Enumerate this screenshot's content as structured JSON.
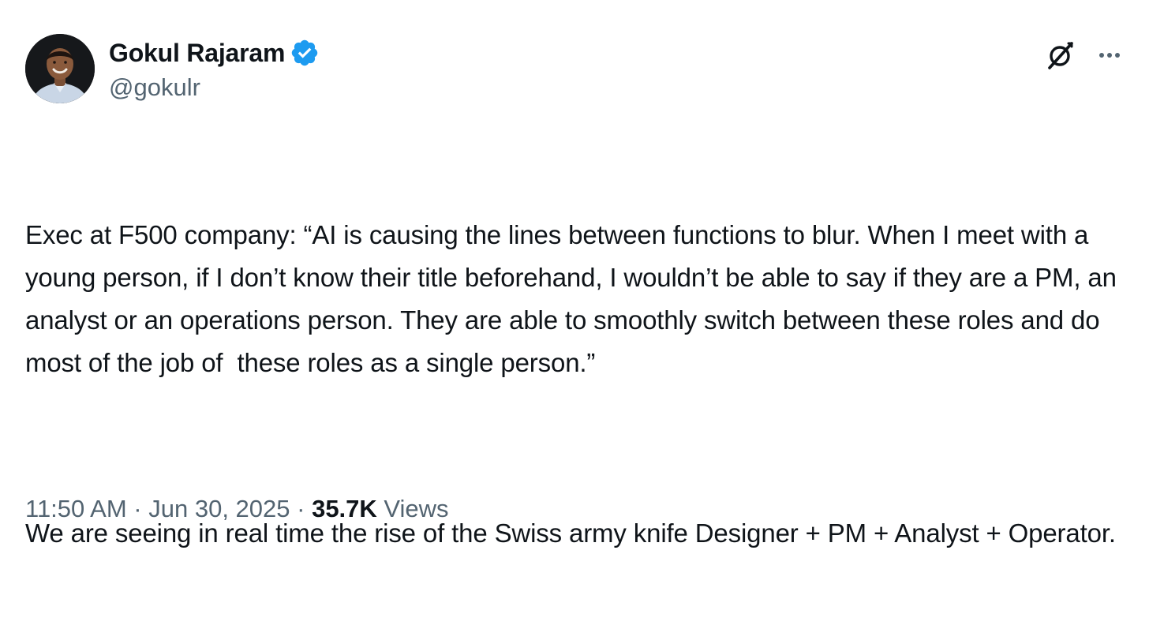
{
  "author": {
    "display_name": "Gokul Rajaram",
    "handle": "@gokulr",
    "verified": true,
    "verified_color": "#1d9bf0"
  },
  "actions": {
    "grok_icon": "grok-icon",
    "more_icon": "more-horizontal-icon"
  },
  "tweet": {
    "paragraphs": [
      "Exec at F500 company: “AI is causing the lines between functions to blur. When I meet with a young person, if I don’t know their title beforehand, I wouldn’t be able to say if they are a PM, an analyst or an operations person. They are able to smoothly switch between these roles and do most of the job of  these roles as a single person.”",
      "We are seeing in real time the rise of the Swiss army knife Designer + PM + Analyst + Operator."
    ]
  },
  "meta": {
    "time": "11:50 AM",
    "separator": " · ",
    "date": "Jun 30, 2025",
    "views_count": "35.7K",
    "views_label": " Views"
  },
  "colors": {
    "text_primary": "#0f1419",
    "text_secondary": "#536471",
    "background": "#ffffff"
  }
}
